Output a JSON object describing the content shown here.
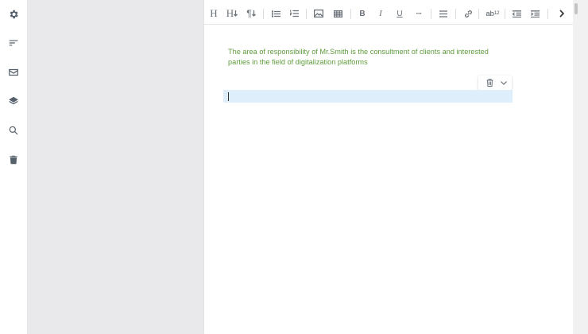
{
  "sidebar": {
    "items": [
      {
        "name": "settings",
        "icon": "gear-icon"
      },
      {
        "name": "sort",
        "icon": "sort-icon"
      },
      {
        "name": "mail",
        "icon": "mail-icon"
      },
      {
        "name": "layers",
        "icon": "layers-icon"
      },
      {
        "name": "search",
        "icon": "search-icon"
      },
      {
        "name": "delete",
        "icon": "trash-icon"
      }
    ]
  },
  "toolbar": {
    "heading": "H",
    "heading_level": "H",
    "paragraph": "¶",
    "bold": "B",
    "italic": "I",
    "underline": "U",
    "more": "···",
    "superscript_base": "ab",
    "superscript_exp": "12"
  },
  "document": {
    "paragraph_text": "The area of responsibility of Mr.Smith is the consultment of clients and interested parties in the field of digitalization platforms",
    "text_color": "#5e9a3c"
  },
  "colors": {
    "active_line": "#deeefb",
    "icon": "#55606b"
  }
}
